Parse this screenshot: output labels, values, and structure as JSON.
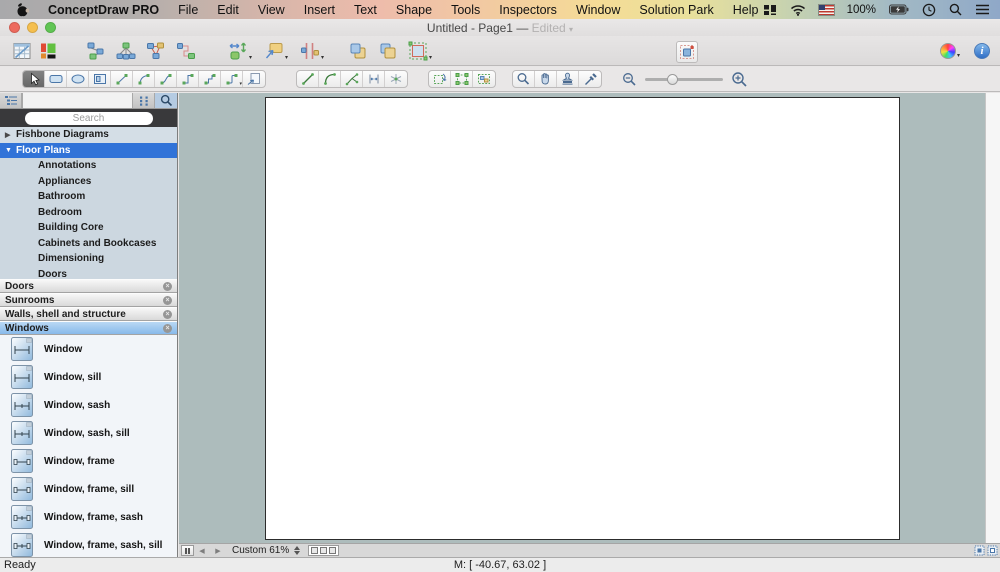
{
  "menu_bar": {
    "app_name": "ConceptDraw PRO",
    "items": [
      "File",
      "Edit",
      "View",
      "Insert",
      "Text",
      "Shape",
      "Tools",
      "Inspectors",
      "Window",
      "Solution Park",
      "Help"
    ],
    "status": {
      "battery": "100%"
    }
  },
  "title_bar": {
    "title": "Untitled - Page1",
    "separator": "—",
    "edited": "Edited"
  },
  "sidebar": {
    "search_placeholder": "Search",
    "tree": {
      "roots": [
        {
          "label": "Fishbone Diagrams"
        },
        {
          "label": "Floor Plans"
        }
      ],
      "children": [
        "Annotations",
        "Appliances",
        "Bathroom",
        "Bedroom",
        "Building Core",
        "Cabinets and Bookcases",
        "Dimensioning",
        "Doors"
      ]
    },
    "panels": [
      {
        "label": "Doors"
      },
      {
        "label": "Sunrooms"
      },
      {
        "label": "Walls, shell and structure"
      },
      {
        "label": "Windows"
      }
    ],
    "shapes": [
      "Window",
      "Window, sill",
      "Window, sash",
      "Window, sash, sill",
      "Window, frame",
      "Window, frame, sill",
      "Window, frame, sash",
      "Window, frame, sash, sill"
    ]
  },
  "canvas": {
    "zoom_value": "Custom 61%"
  },
  "status_bar": {
    "ready": "Ready",
    "mouse_position": "M: [ -40.67, 63.02 ]"
  },
  "icons": {
    "info_glyph": "i",
    "close_glyph": "×"
  },
  "colors": {
    "selection_blue": "#3173d8",
    "canvas_background": "#adbcbc",
    "panel_selected_blue": "#88b9ea",
    "traffic_red": "#ed6a5e",
    "traffic_yellow": "#f5bf4f",
    "traffic_green": "#61c554"
  }
}
